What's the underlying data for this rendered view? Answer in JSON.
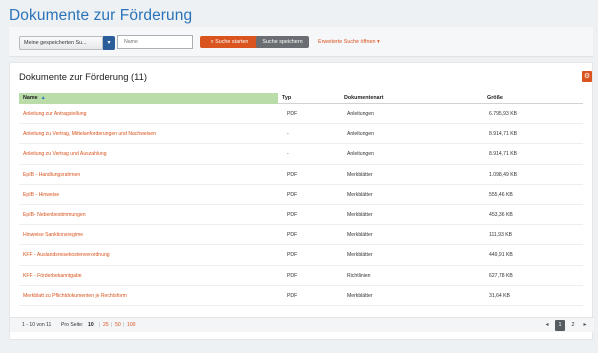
{
  "page": {
    "title": "Dokumente zur Förderung"
  },
  "search": {
    "saved_label": "Meine gespeicherten Su...",
    "caret_icon": "▾",
    "name_placeholder": "Name",
    "search_button": "Suche starten",
    "search_icon": "⌕",
    "save_button": "Suche speichern",
    "advanced_link": "Erweiterte Suche öffnen",
    "advanced_caret": "▾"
  },
  "panel": {
    "title": "Dokumente zur Förderung (11)",
    "gear_icon": "⚙"
  },
  "table": {
    "headers": {
      "name": "Name",
      "sort_icon": "▲",
      "typ": "Typ",
      "art": "Dokumentenart",
      "size": "Größe"
    },
    "rows": [
      {
        "name": "Anleitung zur Antragstellung",
        "typ": "PDF",
        "art": "Anleitungen",
        "size": "6.795,93 KB"
      },
      {
        "name": "Anleitung zu Vertrag, Mittelanforderungen und Nachweisen",
        "typ": "-",
        "art": "Anleitungen",
        "size": "8.914,71 KB"
      },
      {
        "name": "Anleitung zu Vertrag und Auszahlung",
        "typ": "-",
        "art": "Anleitungen",
        "size": "8.914,71 KB"
      },
      {
        "name": "EpIB - Handlungsrahmen",
        "typ": "PDF",
        "art": "Merkblätter",
        "size": "1.098,49 KB"
      },
      {
        "name": "EpIB - Hinweise",
        "typ": "PDF",
        "art": "Merkblätter",
        "size": "555,46 KB"
      },
      {
        "name": "EpIB- Nebenbestimmungen",
        "typ": "PDF",
        "art": "Merkblätter",
        "size": "453,36 KB"
      },
      {
        "name": "Hinweise Sanktionsregime",
        "typ": "PDF",
        "art": "Merkblätter",
        "size": "111,93 KB"
      },
      {
        "name": "KFF - Auslandsreisekostenverordnung",
        "typ": "PDF",
        "art": "Merkblätter",
        "size": "449,91 KB"
      },
      {
        "name": "KFF - Förderbekanntgabe",
        "typ": "PDF",
        "art": "Richtlinien",
        "size": "627,78 KB"
      },
      {
        "name": "Merkblatt zu Pflichtdokumenten je Rechtsform",
        "typ": "PDF",
        "art": "Merkblätter",
        "size": "31,64 KB"
      }
    ]
  },
  "pagination": {
    "info": "1 - 10 von 11",
    "per_page_label": "Pro Seite:",
    "sizes": [
      "10",
      "25",
      "50",
      "100"
    ],
    "sep": "|",
    "prev_icon": "◂",
    "pages": [
      "1",
      "2"
    ],
    "next_icon": "▸"
  }
}
